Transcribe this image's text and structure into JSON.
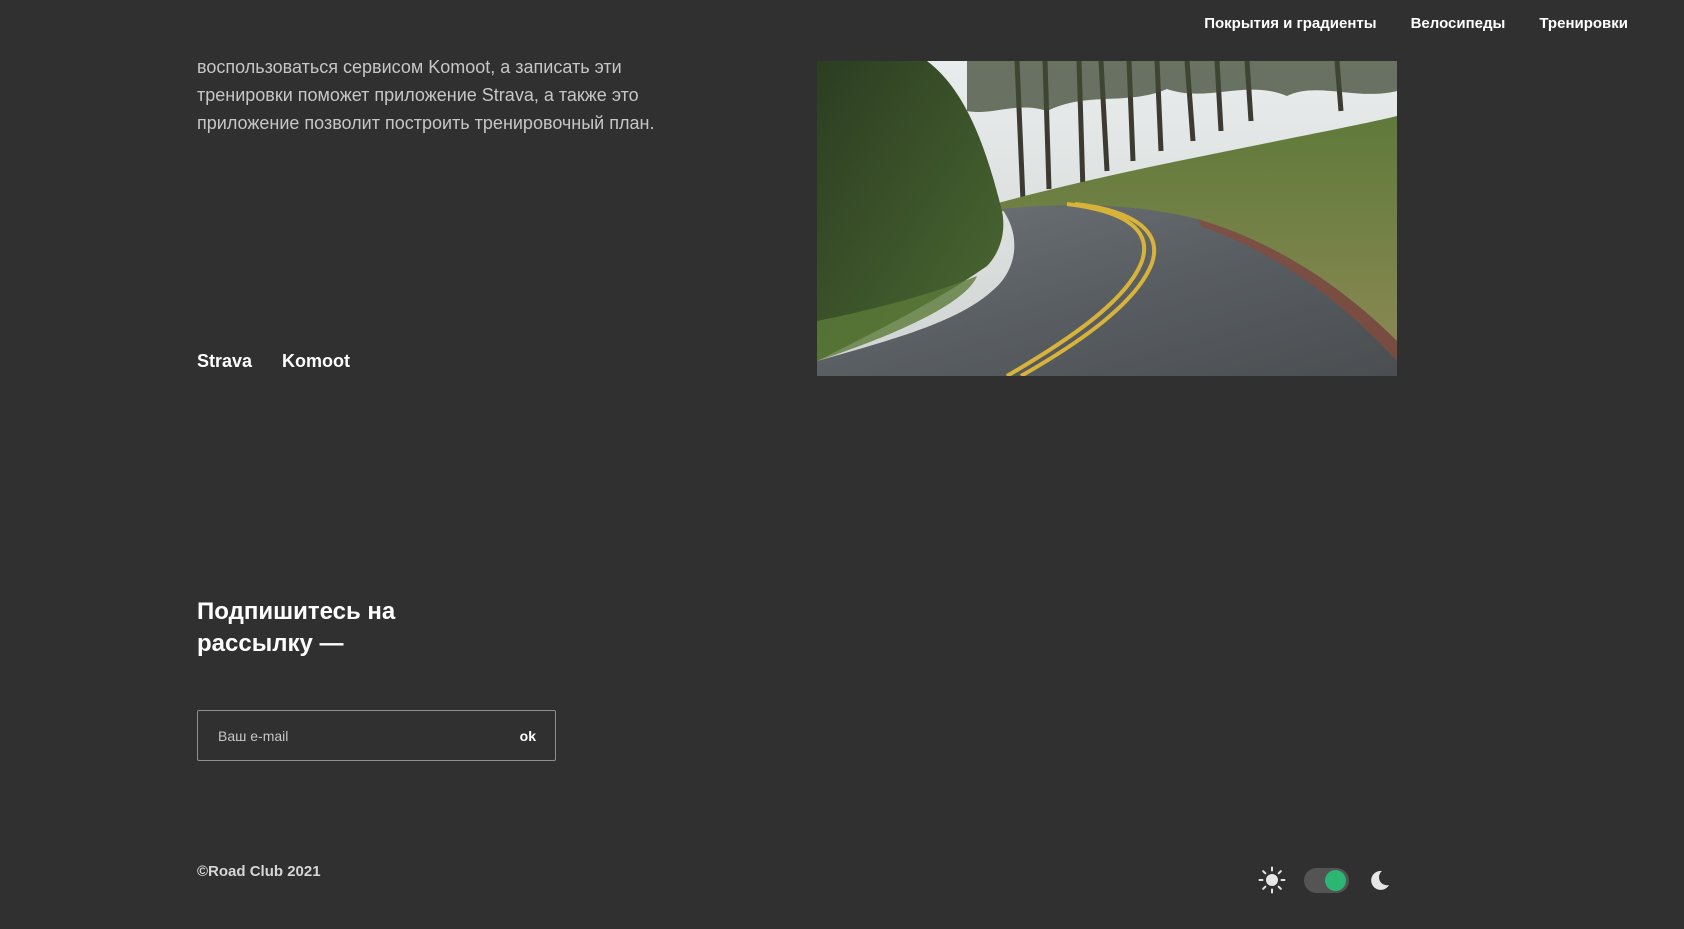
{
  "nav": {
    "items": [
      {
        "label": "Покрытия и градиенты"
      },
      {
        "label": "Велосипеды"
      },
      {
        "label": "Тренировки"
      }
    ]
  },
  "intro": {
    "text": "воспользоваться сервисом Komoot, а записать эти тренировки поможет приложение Strava, а также это приложение позволит построить тренировочный план."
  },
  "links": {
    "items": [
      {
        "label": "Strava"
      },
      {
        "label": "Komoot"
      }
    ]
  },
  "subscribe": {
    "title": "Подпишитесь на рассылку —",
    "placeholder": "Ваш e-mail",
    "button": "ok"
  },
  "footer": {
    "copyright": "©Road Club 2021"
  },
  "theme": {
    "light_icon": "sun-icon",
    "dark_icon": "moon-icon",
    "toggle_state": "dark",
    "accent_color": "#2bb673"
  },
  "colors": {
    "background": "#303030",
    "text": "#ffffff",
    "muted_text": "#c6c6c6"
  }
}
